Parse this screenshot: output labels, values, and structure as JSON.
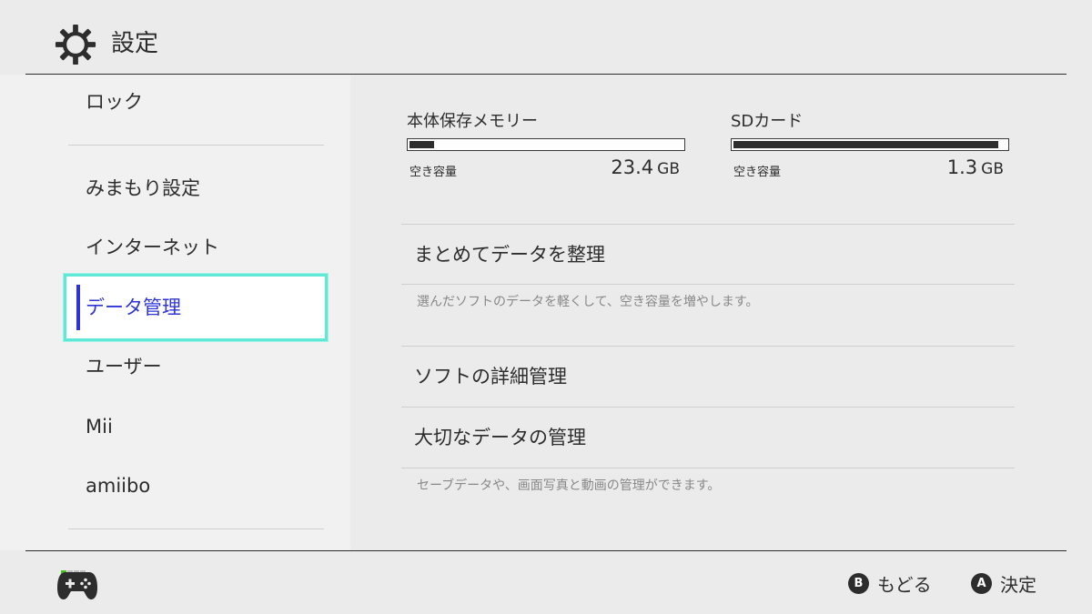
{
  "header": {
    "icon": "gear-icon",
    "title": "設定"
  },
  "sidebar": {
    "items": [
      {
        "label": "ロック"
      },
      {
        "label": "みまもり設定"
      },
      {
        "label": "インターネット"
      },
      {
        "label": "データ管理",
        "selected": true
      },
      {
        "label": "ユーザー"
      },
      {
        "label": "Mii"
      },
      {
        "label": "amiibo"
      }
    ]
  },
  "storage": {
    "system": {
      "title": "本体保存メモリー",
      "free_label": "空き容量",
      "free_value": "23.4",
      "unit": "GB",
      "used_fraction": 0.09
    },
    "sd": {
      "title": "SDカード",
      "free_label": "空き容量",
      "free_value": "1.3",
      "unit": "GB",
      "used_fraction": 0.97
    }
  },
  "menu": {
    "items": [
      {
        "label": "まとめてデータを整理",
        "description": "選んだソフトのデータを軽くして、空き容量を増やします。"
      },
      {
        "label": "ソフトの詳細管理"
      },
      {
        "label": "大切なデータの管理",
        "description": "セーブデータや、画面写真と動画の管理ができます。"
      }
    ]
  },
  "footer": {
    "controller_icon": "gamepad-icon",
    "back": {
      "button": "B",
      "label": "もどる"
    },
    "confirm": {
      "button": "A",
      "label": "決定"
    }
  },
  "colors": {
    "background": "#ebebeb",
    "sidebar": "#f1f1f1",
    "selection_border": "#5fe8d6",
    "selected_text": "#2f34d6",
    "player_indicator": "#47c11b"
  }
}
